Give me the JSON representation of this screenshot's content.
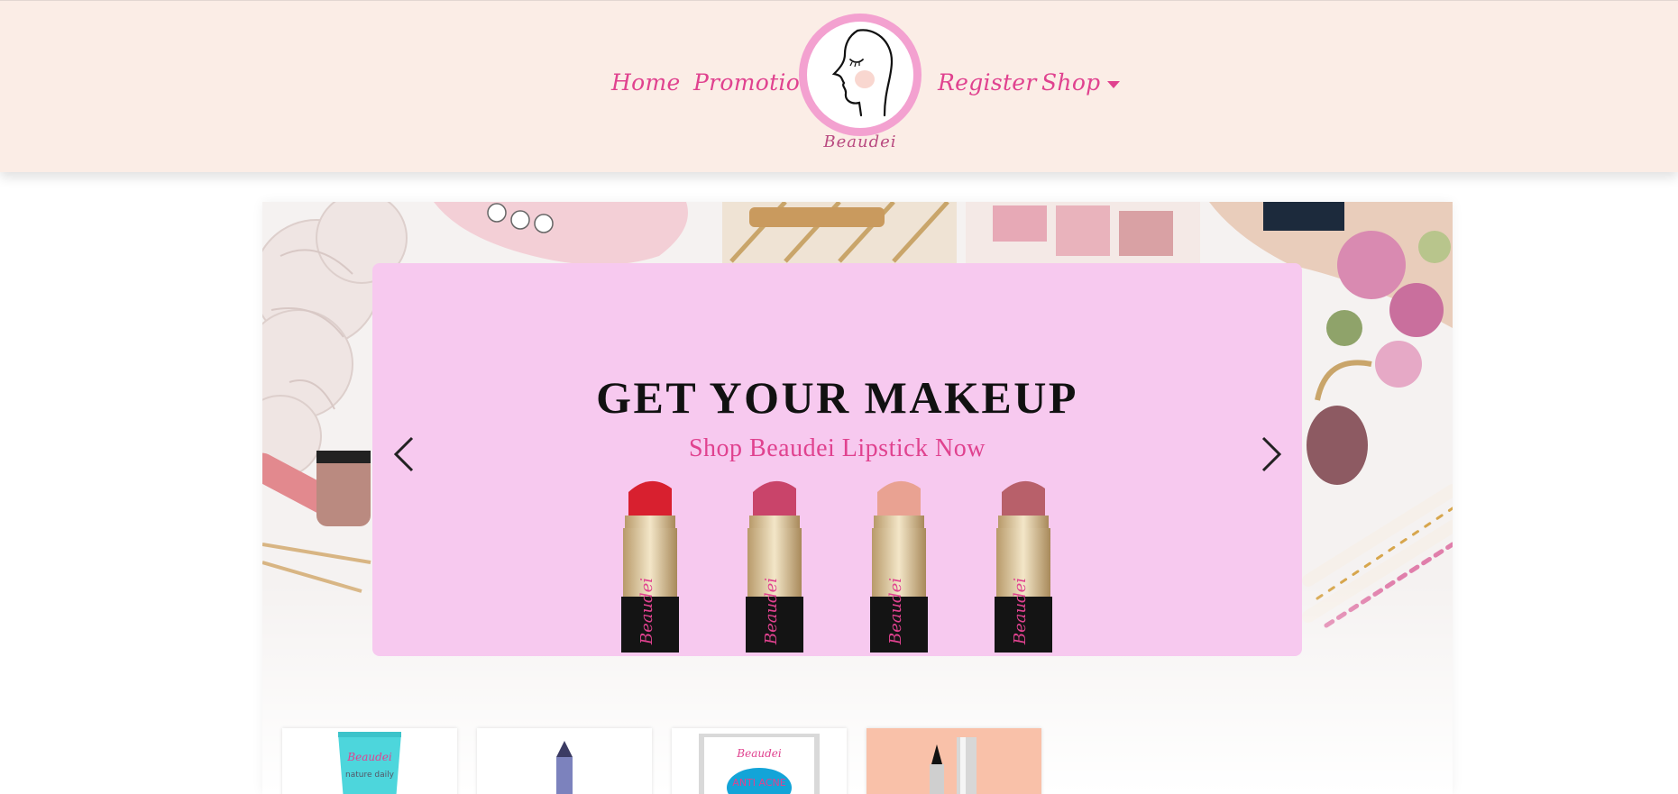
{
  "nav": {
    "home": "Home",
    "promotion": "Promotion",
    "register": "Register",
    "shop": "Shop",
    "shop_icon": "caret-down-icon"
  },
  "logo": {
    "name": "Beaudei"
  },
  "banner": {
    "title": "GET YOUR MAKEUP",
    "subtitle": "Shop Beaudei Lipstick Now",
    "prev_icon": "chevron-left-icon",
    "next_icon": "chevron-right-icon",
    "lipstick_brand": "Beaudei",
    "lipstick_colors": [
      "#d8202f",
      "#c9446a",
      "#e9a292",
      "#b8606a"
    ]
  },
  "products": {
    "brand": "Beaudei",
    "tube_tagline": "nature daily",
    "mask_label": "ANTI ACNE"
  },
  "colors": {
    "accent": "#e0428f",
    "header_bg": "#fbede6",
    "banner_bg": "#f7c9ef",
    "logo_ring": "#f3a1d0"
  }
}
